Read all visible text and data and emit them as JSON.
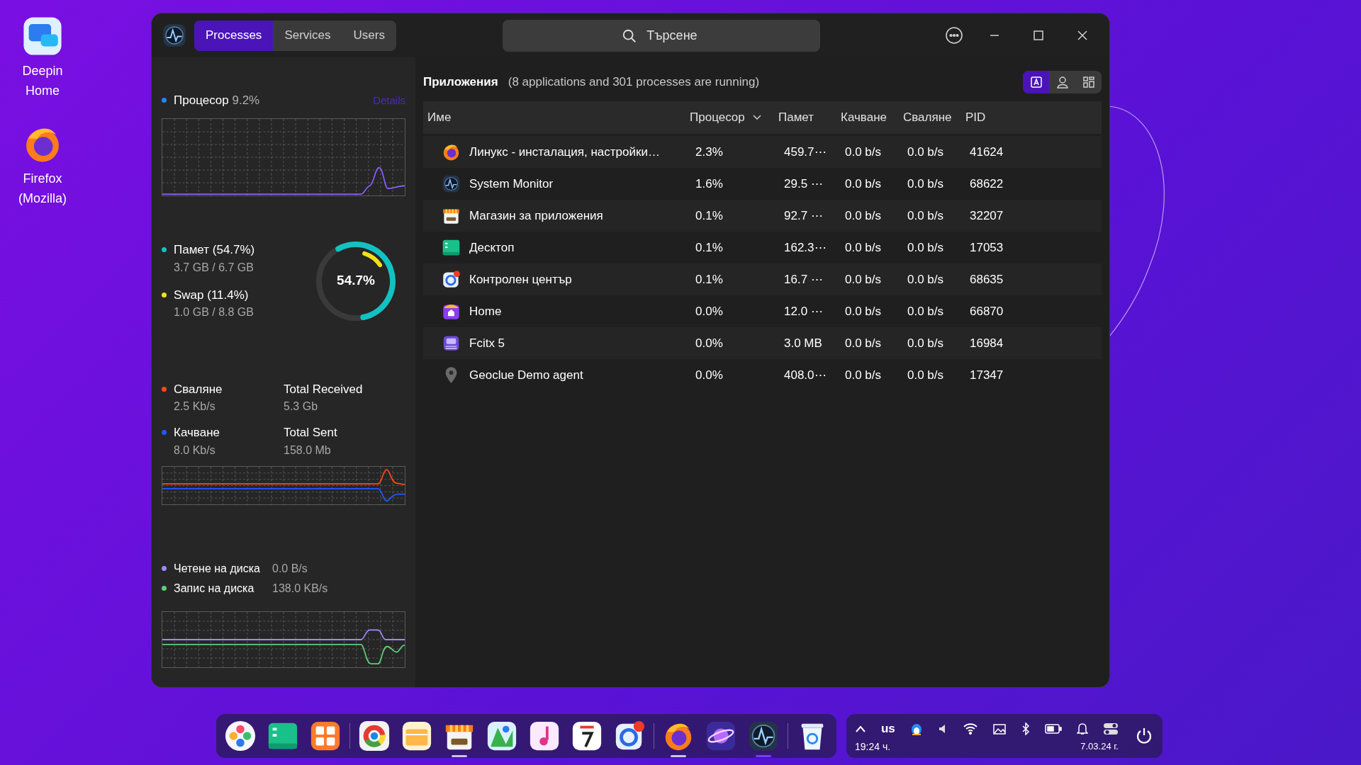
{
  "desktop_icons": [
    {
      "kind": "chat",
      "label": "Deepin Home"
    },
    {
      "kind": "firefox",
      "label": "Firefox (Mozilla)"
    }
  ],
  "window": {
    "tabs": [
      {
        "label": "Processes",
        "selected": true
      },
      {
        "label": "Services",
        "selected": false
      },
      {
        "label": "Users",
        "selected": false
      }
    ],
    "search": {
      "placeholder": "Търсене"
    }
  },
  "overview": {
    "cpu": {
      "label": "Процесор",
      "value": "9.2%",
      "link": "Details"
    },
    "memory": {
      "label": "Памет (54.7%)",
      "detail": "3.7 GB / 6.7 GB"
    },
    "swap": {
      "label": "Swap (11.4%)",
      "detail": "1.0 GB / 8.8 GB"
    },
    "ring_label": "54.7%",
    "network": [
      {
        "label": "Сваляне",
        "value": "2.5 Kb/s",
        "total_label": "Total Received",
        "total_value": "5.3 Gb"
      },
      {
        "label": "Качване",
        "value": "8.0 Kb/s",
        "total_label": "Total Sent",
        "total_value": "158.0 Mb"
      }
    ],
    "disk": [
      {
        "label": "Четене на диска",
        "value": "0.0 B/s"
      },
      {
        "label": "Запис на диска",
        "value": "138.0 KB/s"
      }
    ]
  },
  "table": {
    "title": "Приложения",
    "summary": "(8 applications and 301 processes are running)",
    "views": [
      {
        "kind": "apps",
        "selected": true
      },
      {
        "kind": "user",
        "selected": false
      },
      {
        "kind": "tree",
        "selected": false
      }
    ],
    "columns": [
      {
        "label": "Име",
        "sorted": false
      },
      {
        "label": "Процесор",
        "sorted": true
      },
      {
        "label": "Памет",
        "sorted": false
      },
      {
        "label": "Качване",
        "sorted": false
      },
      {
        "label": "Сваляне",
        "sorted": false
      },
      {
        "label": "PID",
        "sorted": false
      }
    ],
    "rows": [
      {
        "kind": "firefox",
        "name": "Линукс - инсталация, настройки…",
        "cpu": "2.3%",
        "memory": "459.7⋯",
        "upload": "0.0 b/s",
        "download": "0.0 b/s",
        "pid": "41624"
      },
      {
        "kind": "monitor",
        "name": "System Monitor",
        "cpu": "1.6%",
        "memory": "29.5 ⋯",
        "upload": "0.0 b/s",
        "download": "0.0 b/s",
        "pid": "68622"
      },
      {
        "kind": "store",
        "name": "Магазин за приложения",
        "cpu": "0.1%",
        "memory": "92.7 ⋯",
        "upload": "0.0 b/s",
        "download": "0.0 b/s",
        "pid": "32207"
      },
      {
        "kind": "desktop",
        "name": "Десктоп",
        "cpu": "0.1%",
        "memory": "162.3⋯",
        "upload": "0.0 b/s",
        "download": "0.0 b/s",
        "pid": "17053"
      },
      {
        "kind": "control",
        "name": "Контролен център",
        "cpu": "0.1%",
        "memory": "16.7 ⋯",
        "upload": "0.0 b/s",
        "download": "0.0 b/s",
        "pid": "68635"
      },
      {
        "kind": "home",
        "name": "Home",
        "cpu": "0.0%",
        "memory": "12.0 ⋯",
        "upload": "0.0 b/s",
        "download": "0.0 b/s",
        "pid": "66870"
      },
      {
        "kind": "fcitx",
        "name": "Fcitx 5",
        "cpu": "0.0%",
        "memory": "3.0 MB",
        "upload": "0.0 b/s",
        "download": "0.0 b/s",
        "pid": "16984"
      },
      {
        "kind": "pin",
        "name": "Geoclue Demo agent",
        "cpu": "0.0%",
        "memory": "408.0⋯",
        "upload": "0.0 b/s",
        "download": "0.0 b/s",
        "pid": "17347"
      }
    ]
  },
  "dock": {
    "groups": [
      [
        {
          "kind": "launcher",
          "running": false,
          "active": false
        },
        {
          "kind": "desktop",
          "running": false,
          "active": false
        },
        {
          "kind": "tiles",
          "running": false,
          "active": false
        }
      ],
      [
        {
          "kind": "chrome",
          "running": false,
          "active": false
        },
        {
          "kind": "files",
          "running": false,
          "active": false
        },
        {
          "kind": "store",
          "running": true,
          "active": false
        },
        {
          "kind": "maps",
          "running": false,
          "active": false
        },
        {
          "kind": "music",
          "running": false,
          "active": false
        },
        {
          "kind": "calendar",
          "running": false,
          "active": false
        },
        {
          "kind": "control",
          "running": false,
          "active": false
        }
      ],
      [
        {
          "kind": "firefox",
          "running": true,
          "active": false
        },
        {
          "kind": "planet",
          "running": false,
          "active": false
        },
        {
          "kind": "monitor",
          "running": true,
          "active": true
        }
      ],
      [
        {
          "kind": "trash",
          "running": false,
          "active": false
        }
      ]
    ],
    "tray": {
      "keyboard": "us",
      "time": "19:24 ч.",
      "date": "7.03.24 г."
    }
  }
}
